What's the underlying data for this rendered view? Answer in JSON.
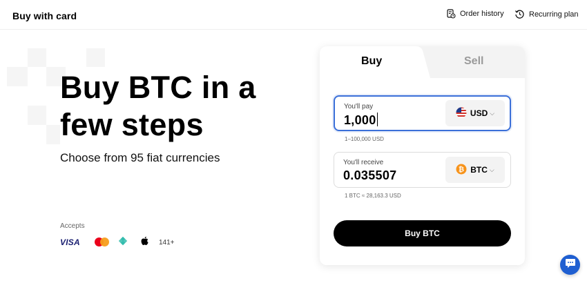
{
  "header": {
    "title": "Buy with card",
    "links": {
      "order_history": {
        "label": "Order history",
        "icon": "order-history-icon"
      },
      "recurring_plan": {
        "label": "Recurring plan",
        "icon": "recurring-plan-icon"
      }
    }
  },
  "hero": {
    "title": "Buy BTC in a few steps",
    "subtitle": "Choose from 95 fiat currencies",
    "accepts_label": "Accepts",
    "payment_methods": [
      "visa-logo",
      "mastercard-logo",
      "pix-logo",
      "apple-logo"
    ],
    "visa_text": "VISA",
    "more_count": "141+"
  },
  "trade_card": {
    "tabs": {
      "buy": "Buy",
      "sell": "Sell"
    },
    "active_tab": "Buy",
    "pay": {
      "label": "You'll pay",
      "value": "1,000",
      "currency": "USD",
      "currency_icon": "us-flag-icon",
      "range_hint": "1–100,000 USD"
    },
    "receive": {
      "label": "You'll receive",
      "value": "0.035507",
      "currency": "BTC",
      "currency_icon": "bitcoin-icon",
      "rate_hint": "1 BTC ≈ 28,163.3 USD"
    },
    "submit_label": "Buy BTC"
  },
  "colors": {
    "accent_blue": "#1f5fd1",
    "focus_border": "#3a6fd8",
    "button_black": "#000000",
    "bitcoin_orange": "#f7931a"
  },
  "chat": {
    "icon": "chat-icon"
  }
}
